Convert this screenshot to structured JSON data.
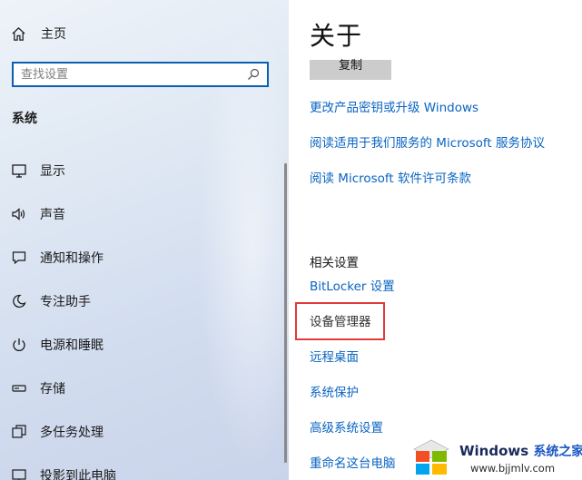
{
  "sidebar": {
    "home_label": "主页",
    "search_placeholder": "查找设置",
    "section_title": "系统",
    "items": [
      {
        "label": "显示",
        "icon": "monitor-icon"
      },
      {
        "label": "声音",
        "icon": "speaker-icon"
      },
      {
        "label": "通知和操作",
        "icon": "notification-icon"
      },
      {
        "label": "专注助手",
        "icon": "moon-icon"
      },
      {
        "label": "电源和睡眠",
        "icon": "power-icon"
      },
      {
        "label": "存储",
        "icon": "storage-icon"
      },
      {
        "label": "多任务处理",
        "icon": "multitask-icon"
      },
      {
        "label": "投影到此电脑",
        "icon": "project-icon"
      }
    ]
  },
  "main": {
    "title": "关于",
    "copy_label": "复制",
    "links": [
      "更改产品密钥或升级 Windows",
      "阅读适用于我们服务的 Microsoft 服务协议",
      "阅读 Microsoft 软件许可条款"
    ],
    "related_title": "相关设置",
    "related_links": [
      "BitLocker 设置",
      "设备管理器",
      "远程桌面",
      "系统保护",
      "高级系统设置",
      "重命名这台电脑"
    ]
  },
  "watermark": {
    "brand": "Windows",
    "brand_cn": "系统之家",
    "url": "www.bjjmlv.com"
  },
  "colors": {
    "accent": "#0a64c2",
    "highlight_box": "#e03a3a",
    "search_border": "#0b5fb0"
  }
}
